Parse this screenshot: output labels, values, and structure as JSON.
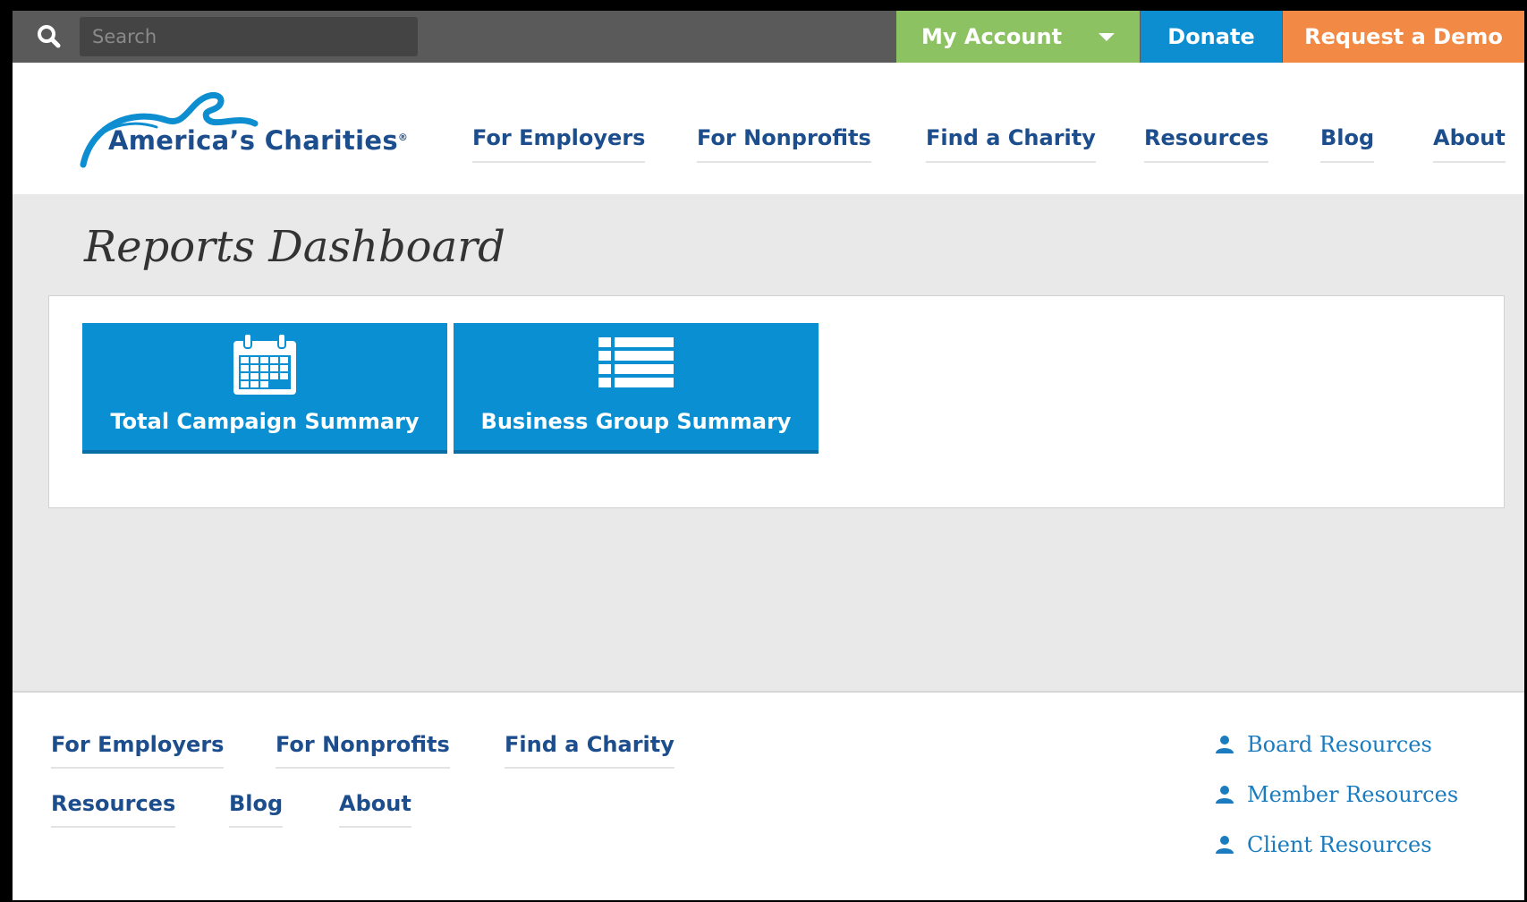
{
  "topbar": {
    "search_placeholder": "Search",
    "my_account_label": "My Account",
    "donate_label": "Donate",
    "request_demo_label": "Request a Demo"
  },
  "brand": {
    "name": "America’s Charities",
    "registered_mark": "®",
    "color": "#1c4d8c",
    "wave_color": "#0d8ed1"
  },
  "main_nav": [
    {
      "label": "For Employers"
    },
    {
      "label": "For Nonprofits"
    },
    {
      "label": "Find a Charity"
    },
    {
      "label": "Resources"
    },
    {
      "label": "Blog"
    },
    {
      "label": "About"
    }
  ],
  "page": {
    "title": "Reports Dashboard"
  },
  "tiles": [
    {
      "label": "Total Campaign Summary",
      "icon": "calendar-icon"
    },
    {
      "label": "Business Group Summary",
      "icon": "list-icon"
    }
  ],
  "footer": {
    "nav": [
      {
        "label": "For Employers"
      },
      {
        "label": "For Nonprofits"
      },
      {
        "label": "Find a Charity"
      },
      {
        "label": "Resources"
      },
      {
        "label": "Blog"
      },
      {
        "label": "About"
      }
    ],
    "resources": [
      {
        "label": "Board Resources",
        "icon": "user-icon"
      },
      {
        "label": "Member Resources",
        "icon": "user-icon"
      },
      {
        "label": "Client Resources",
        "icon": "user-icon"
      }
    ]
  },
  "colors": {
    "account_green": "#8cc262",
    "donate_blue": "#0d8ed1",
    "demo_orange": "#f28a45",
    "tile_blue": "#0a8fd3",
    "nav_text": "#1c4d8c"
  }
}
